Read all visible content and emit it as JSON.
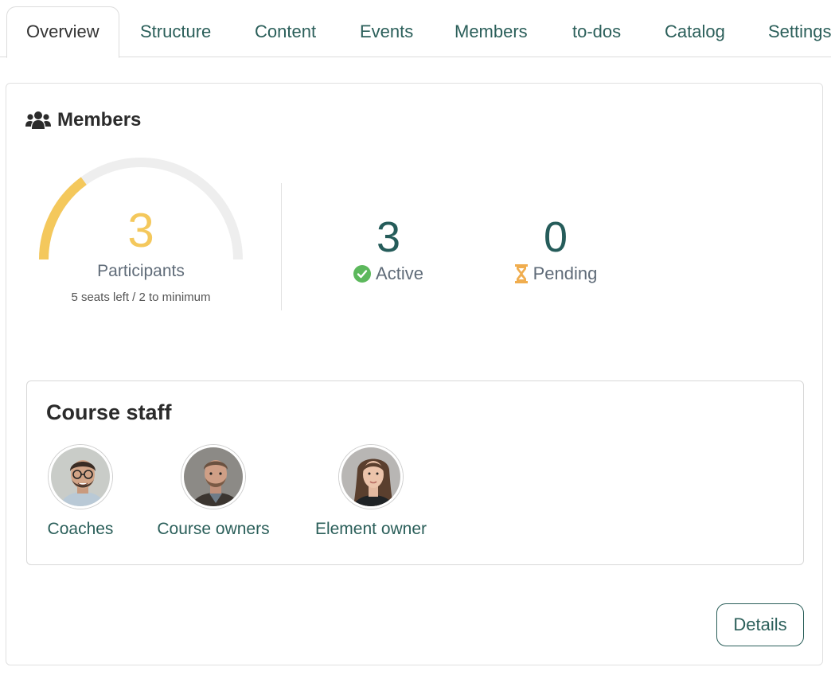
{
  "tabs": [
    {
      "label": "Overview"
    },
    {
      "label": "Structure"
    },
    {
      "label": "Content"
    },
    {
      "label": "Events"
    },
    {
      "label": "Members"
    },
    {
      "label": "to-dos"
    },
    {
      "label": "Catalog"
    },
    {
      "label": "Settings"
    }
  ],
  "active_tab": "Overview",
  "members": {
    "title": "Members",
    "icon": "users-icon",
    "participants": {
      "value": "3",
      "label": "Participants",
      "subtitle": "5 seats left / 2 to minimum",
      "fill_fraction": 0.3
    },
    "active": {
      "value": "3",
      "label": "Active",
      "icon": "check-circle-icon"
    },
    "pending": {
      "value": "0",
      "label": "Pending",
      "icon": "hourglass-icon"
    }
  },
  "staff": {
    "title": "Course staff",
    "people": [
      {
        "label": "Coaches"
      },
      {
        "label": "Course owners"
      },
      {
        "label": "Element owner"
      }
    ]
  },
  "details_label": "Details",
  "colors": {
    "accent": "#2b5f5a",
    "gauge_fill": "#f4c85c",
    "gauge_track": "#eeeeee",
    "active_green": "#5cb85c",
    "pending_orange": "#f0ad4e"
  }
}
